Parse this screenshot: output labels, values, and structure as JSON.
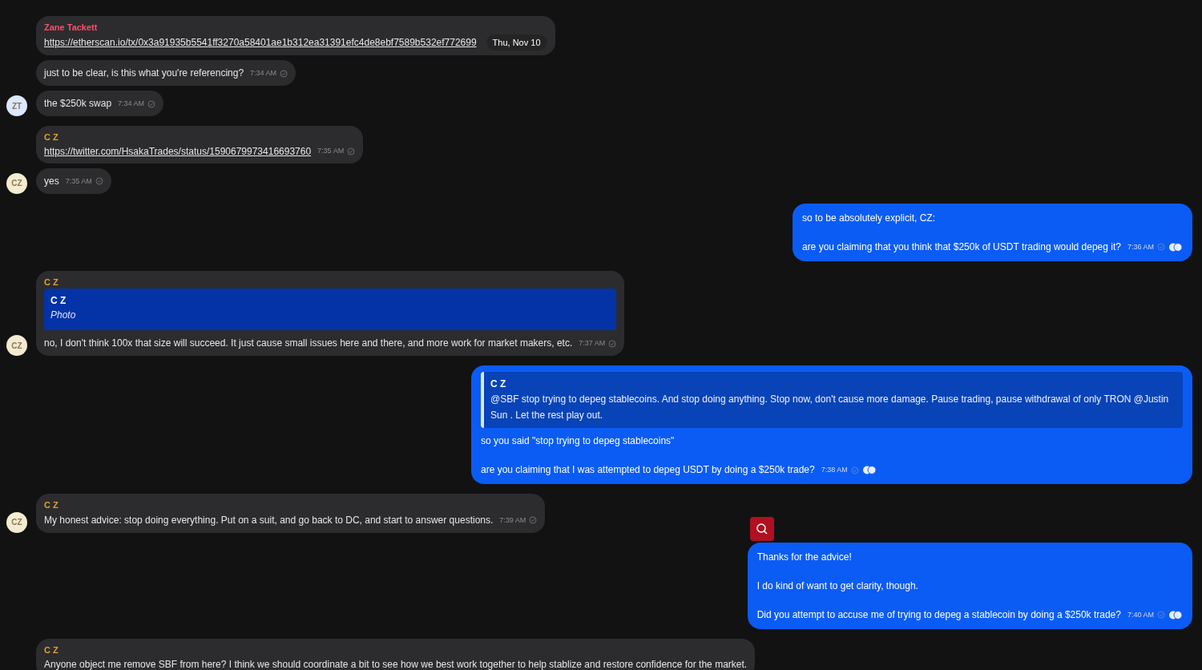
{
  "messages": [
    {
      "kind": "incoming",
      "sender": "Zane Tackett",
      "color": "#ff4d6d",
      "link": "https://etherscan.io/tx/0x3a91935b5541ff3270a58401ae1b312ea31391efc4de8ebf7589b532ef772699",
      "date_badge": "Thu, Nov 10"
    },
    {
      "kind": "incoming",
      "lines": [
        "just to be clear, is this what you're referencing?"
      ],
      "time": "7:34 AM"
    },
    {
      "kind": "incoming",
      "lines": [
        "the $250k swap"
      ],
      "time": "7:34 AM",
      "avatar": {
        "initials": "ZT",
        "color": "#dce8ff"
      }
    },
    {
      "kind": "incoming",
      "sender": "C Z",
      "color": "#e0a030",
      "link": "https://twitter.com/HsakaTrades/status/1590679973416693760",
      "time": "7:35 AM"
    },
    {
      "kind": "incoming",
      "lines": [
        "yes"
      ],
      "time": "7:35 AM",
      "avatar": {
        "initials": "CZ",
        "color": "#f3ecd2"
      }
    },
    {
      "kind": "outgoing",
      "lines": [
        "so to be absolutely explicit, CZ:",
        "are you claiming that you think that $250k of USDT trading would depeg it?"
      ],
      "time": "7:36 AM",
      "seen": true
    },
    {
      "kind": "incoming",
      "sender": "C Z",
      "color": "#e0a030",
      "quote": {
        "kind": "photo",
        "author": "C Z",
        "text": "Photo"
      },
      "lines": [
        "no, I don't think 100x that size will succeed. It just cause small issues here and there, and more work for market makers, etc."
      ],
      "time": "7:37 AM",
      "avatar": {
        "initials": "CZ",
        "color": "#f3ecd2"
      }
    },
    {
      "kind": "outgoing",
      "quote": {
        "kind": "text",
        "author": "C Z",
        "text": "@SBF  stop trying to depeg stablecoins. And stop doing anything. Stop now, don't cause more damage. Pause trading, pause withdrawal of only TRON @Justin Sun . Let the rest play out."
      },
      "lines": [
        "so you said \"stop trying to depeg stablecoins\"",
        "are you claiming that I was attempted to depeg USDT by doing a $250k trade?"
      ],
      "time": "7:38 AM",
      "seen": true
    },
    {
      "kind": "incoming",
      "sender": "C Z",
      "color": "#e0a030",
      "lines": [
        "My honest advice: stop doing everything. Put on a suit, and go back to DC, and start to answer questions."
      ],
      "time": "7:39 AM",
      "avatar": {
        "initials": "CZ",
        "color": "#f3ecd2"
      }
    },
    {
      "kind": "outgoing",
      "lines": [
        "Thanks for the advice!",
        "I do kind of want to get clarity, though.",
        "Did you attempt to accuse me of trying to depeg a stablecoin by doing a $250k trade?"
      ],
      "time": "7:40 AM",
      "seen": true
    },
    {
      "kind": "incoming",
      "sender": "C Z",
      "color": "#e0a030",
      "lines": [
        "Anyone object me remove SBF from here? I think we should coordinate a bit to see how we best work together to help stablize and restore confidence for the market."
      ]
    }
  ]
}
